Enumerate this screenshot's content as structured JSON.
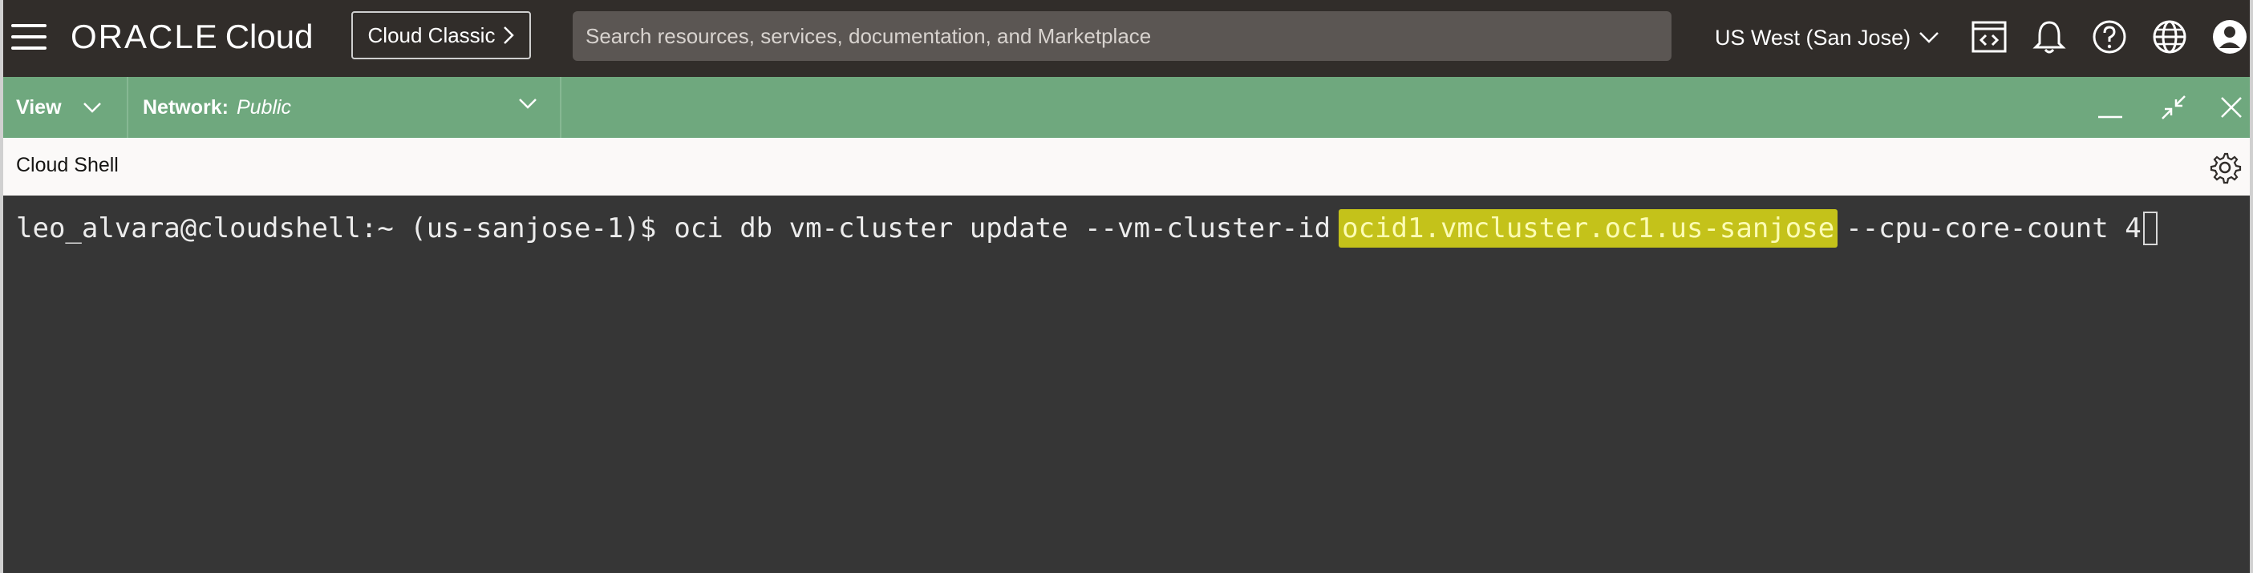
{
  "header": {
    "menu_icon": "hamburger-menu-icon",
    "logo_word": "ORACLE",
    "logo_cloud": "Cloud",
    "classic_button": "Cloud Classic",
    "search_placeholder": "Search resources, services, documentation, and Marketplace",
    "region": "US West (San Jose)",
    "icons": [
      "code-editor-icon",
      "bell-icon",
      "help-icon",
      "globe-icon",
      "user-profile-icon"
    ]
  },
  "toolbar": {
    "view_label": "View",
    "network_label": "Network:",
    "network_value": "Public",
    "controls": [
      "minimize-icon",
      "restore-icon",
      "close-icon"
    ],
    "color": "#6fa87e"
  },
  "shell": {
    "title": "Cloud Shell",
    "prompt": "leo_alvara@cloudshell:~ (us-sanjose-1)$",
    "command_before": "oci db vm-cluster update --vm-cluster-id",
    "highlighted": "ocid1.vmcluster.oc1.us-sanjose",
    "command_after": "--cpu-core-count 4",
    "highlight_color": "#c4c21a"
  }
}
